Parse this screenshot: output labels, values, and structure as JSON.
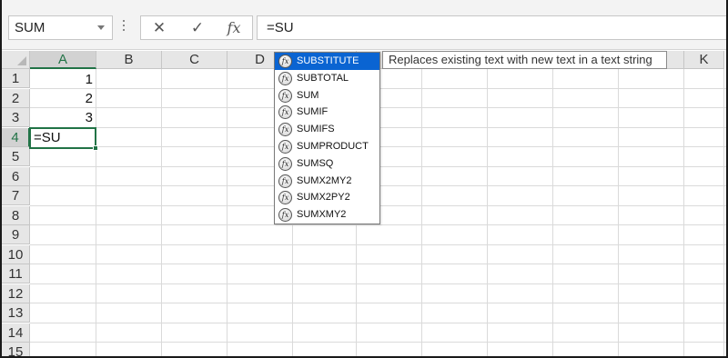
{
  "name_box": {
    "value": "SUM"
  },
  "formula_bar": {
    "cancel_glyph": "✕",
    "enter_glyph": "✓",
    "fx_label": "fx",
    "value": "=SU"
  },
  "columns": [
    "A",
    "B",
    "C",
    "D",
    "E",
    "F",
    "G",
    "H",
    "I",
    "J",
    "K"
  ],
  "rows": [
    "1",
    "2",
    "3",
    "4",
    "5",
    "6",
    "7",
    "8",
    "9",
    "10",
    "11",
    "12",
    "13",
    "14",
    "15"
  ],
  "cells": {
    "A1": "1",
    "A2": "2",
    "A3": "3",
    "A4": "=SU"
  },
  "autocomplete": {
    "icon_label": "fx",
    "items": [
      "SUBSTITUTE",
      "SUBTOTAL",
      "SUM",
      "SUMIF",
      "SUMIFS",
      "SUMPRODUCT",
      "SUMSQ",
      "SUMX2MY2",
      "SUMX2PY2",
      "SUMXMY2"
    ],
    "selected": "SUBSTITUTE",
    "tooltip": "Replaces existing text with new text in a text string"
  },
  "colors": {
    "accent": "#217346",
    "highlight": "#0a64d2"
  }
}
